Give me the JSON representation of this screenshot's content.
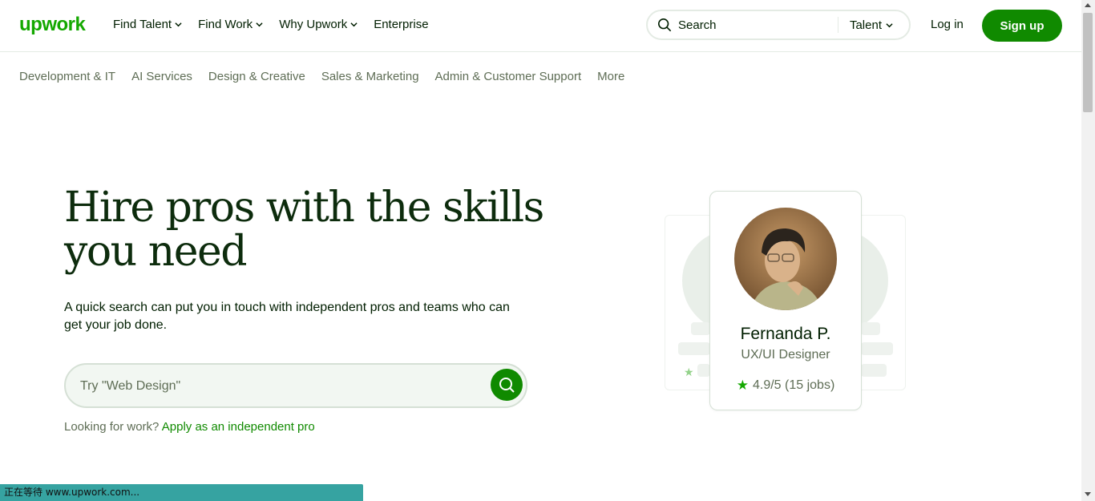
{
  "header": {
    "logo": "upwork",
    "nav": [
      {
        "label": "Find Talent",
        "has_dropdown": true
      },
      {
        "label": "Find Work",
        "has_dropdown": true
      },
      {
        "label": "Why Upwork",
        "has_dropdown": true
      },
      {
        "label": "Enterprise",
        "has_dropdown": false
      }
    ],
    "search": {
      "label": "Search",
      "scope": "Talent"
    },
    "login": "Log in",
    "signup": "Sign up"
  },
  "categories": [
    "Development & IT",
    "AI Services",
    "Design & Creative",
    "Sales & Marketing",
    "Admin & Customer Support",
    "More"
  ],
  "hero": {
    "title_line1": "Hire pros with the skills",
    "title_line2": "you need",
    "subtitle": "A quick search can put you in touch with independent pros and teams who can get your job done.",
    "search_placeholder": "Try \"Web Design\"",
    "work_prompt": "Looking for work?",
    "work_link": "Apply as an independent pro"
  },
  "profile_card": {
    "name": "Fernanda P.",
    "role": "UX/UI Designer",
    "rating": "4.9/5 (15 jobs)"
  },
  "status_bar": "正在等待 www.upwork.com...",
  "colors": {
    "brand_green": "#14a800",
    "button_green": "#108a00",
    "text_dark": "#001e00",
    "text_muted": "#5e6d55",
    "status_teal": "#36a3a1"
  }
}
